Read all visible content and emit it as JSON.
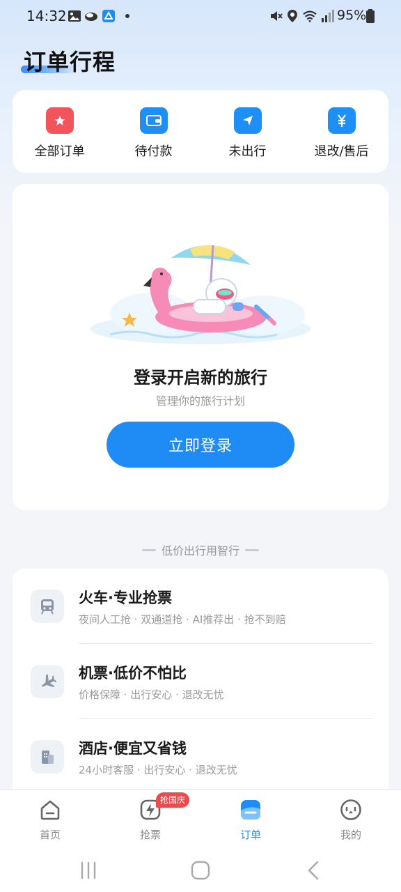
{
  "status_bar": {
    "time": "14:32",
    "battery": "95%",
    "left_icons": [
      "gallery-icon",
      "cloud-icon",
      "app-icon",
      "dot-icon"
    ],
    "right_icons": [
      "mute-icon",
      "location-icon",
      "wifi-icon",
      "signal-icon",
      "battery-icon"
    ]
  },
  "page": {
    "title": "订单行程"
  },
  "quick_actions": [
    {
      "label": "全部订单",
      "icon": "all-orders-icon",
      "color": "#f2545b"
    },
    {
      "label": "待付款",
      "icon": "wallet-icon",
      "color": "#1d8ff5"
    },
    {
      "label": "未出行",
      "icon": "plane-tag-icon",
      "color": "#1d8ff5"
    },
    {
      "label": "退改/售后",
      "icon": "yuan-refund-icon",
      "color": "#1d8ff5"
    }
  ],
  "login_card": {
    "title": "登录开启新的旅行",
    "subtitle": "管理你的旅行计划",
    "button": "立即登录"
  },
  "section": {
    "divider_text": "低价出行用智行"
  },
  "services": [
    {
      "title": "火车·专业抢票",
      "desc": "夜间人工抢 · 双通道抢 · AI推荐出 · 抢不到赔",
      "icon": "train-icon"
    },
    {
      "title": "机票·低价不怕比",
      "desc": "价格保障 · 出行安心 · 退改无忧",
      "icon": "plane-icon"
    },
    {
      "title": "酒店·便宜又省钱",
      "desc": "24小时客服 · 出行安心 · 退改无忧",
      "icon": "hotel-icon"
    }
  ],
  "bottom_nav": {
    "items": [
      {
        "label": "首页",
        "icon": "home-icon",
        "active": false
      },
      {
        "label": "抢票",
        "icon": "lightning-icon",
        "active": false,
        "badge": "抢国庆"
      },
      {
        "label": "订单",
        "icon": "orders-icon",
        "active": true
      },
      {
        "label": "我的",
        "icon": "profile-icon",
        "active": false
      }
    ]
  },
  "colors": {
    "accent": "#1f8cf5",
    "badge": "#f2474b",
    "all_orders": "#f2545b"
  }
}
